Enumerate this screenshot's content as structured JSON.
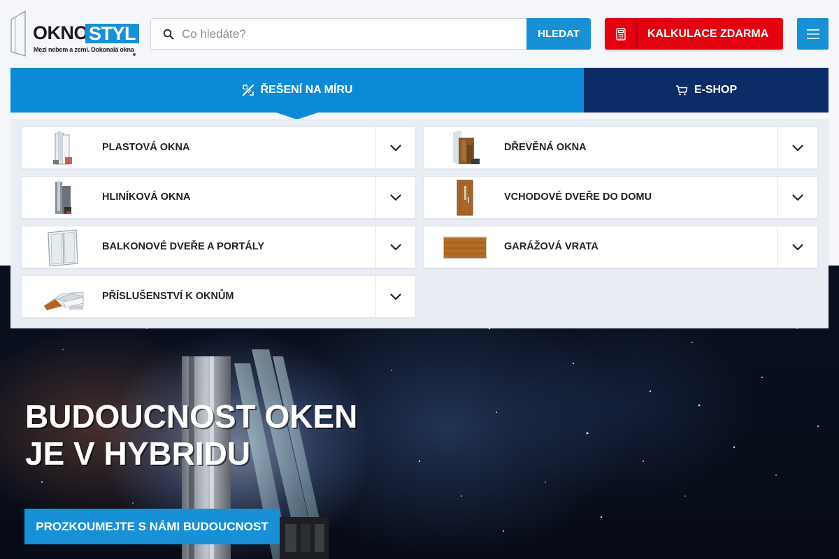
{
  "logo": {
    "part1": "OKNO",
    "part2": "STYL",
    "tagline": "Mezi nebem a zemí. Dokonalá okna"
  },
  "search": {
    "placeholder": "Co hledáte?",
    "button_label": "HLEDAT",
    "icon": "search-icon"
  },
  "calculator": {
    "label": "KALKULACE ZDARMA",
    "icon": "calculator-icon",
    "color": "#e3000f"
  },
  "menu": {
    "icon": "hamburger-menu-icon"
  },
  "tabs": [
    {
      "label": "ŘEŠENÍ NA MÍRU",
      "icon": "ruler-pencil-icon",
      "active": true,
      "color": "#0b8ad6"
    },
    {
      "label": "E-SHOP",
      "icon": "cart-icon",
      "active": false,
      "color": "#0b2c67"
    }
  ],
  "categories": [
    {
      "label": "PLASTOVÁ OKNA",
      "thumbnail": "plastic-window-profile",
      "toggle_icon": "chevron-down-icon"
    },
    {
      "label": "DŘEVĚNÁ OKNA",
      "thumbnail": "wooden-window-profile",
      "toggle_icon": "chevron-down-icon"
    },
    {
      "label": "HLINÍKOVÁ OKNA",
      "thumbnail": "aluminium-window-profile",
      "toggle_icon": "chevron-down-icon"
    },
    {
      "label": "VCHODOVÉ DVEŘE DO DOMU",
      "thumbnail": "entrance-door",
      "toggle_icon": "chevron-down-icon"
    },
    {
      "label": "BALKONOVÉ DVEŘE A PORTÁLY",
      "thumbnail": "balcony-door",
      "toggle_icon": "chevron-down-icon"
    },
    {
      "label": "GARÁŽOVÁ VRATA",
      "thumbnail": "garage-door",
      "toggle_icon": "chevron-down-icon"
    },
    {
      "label": "PŘÍSLUŠENSTVÍ K OKNŮM",
      "thumbnail": "window-accessories",
      "toggle_icon": "chevron-down-icon"
    }
  ],
  "hero": {
    "title_line1": "BUDOUCNOST OKEN",
    "title_line2": "JE V HYBRIDU",
    "cta_label": "PROZKOUMEJTE S NÁMI BUDOUCNOST"
  },
  "colors": {
    "brand_blue": "#1890d5",
    "navy": "#0b2c67",
    "red": "#e3000f"
  }
}
